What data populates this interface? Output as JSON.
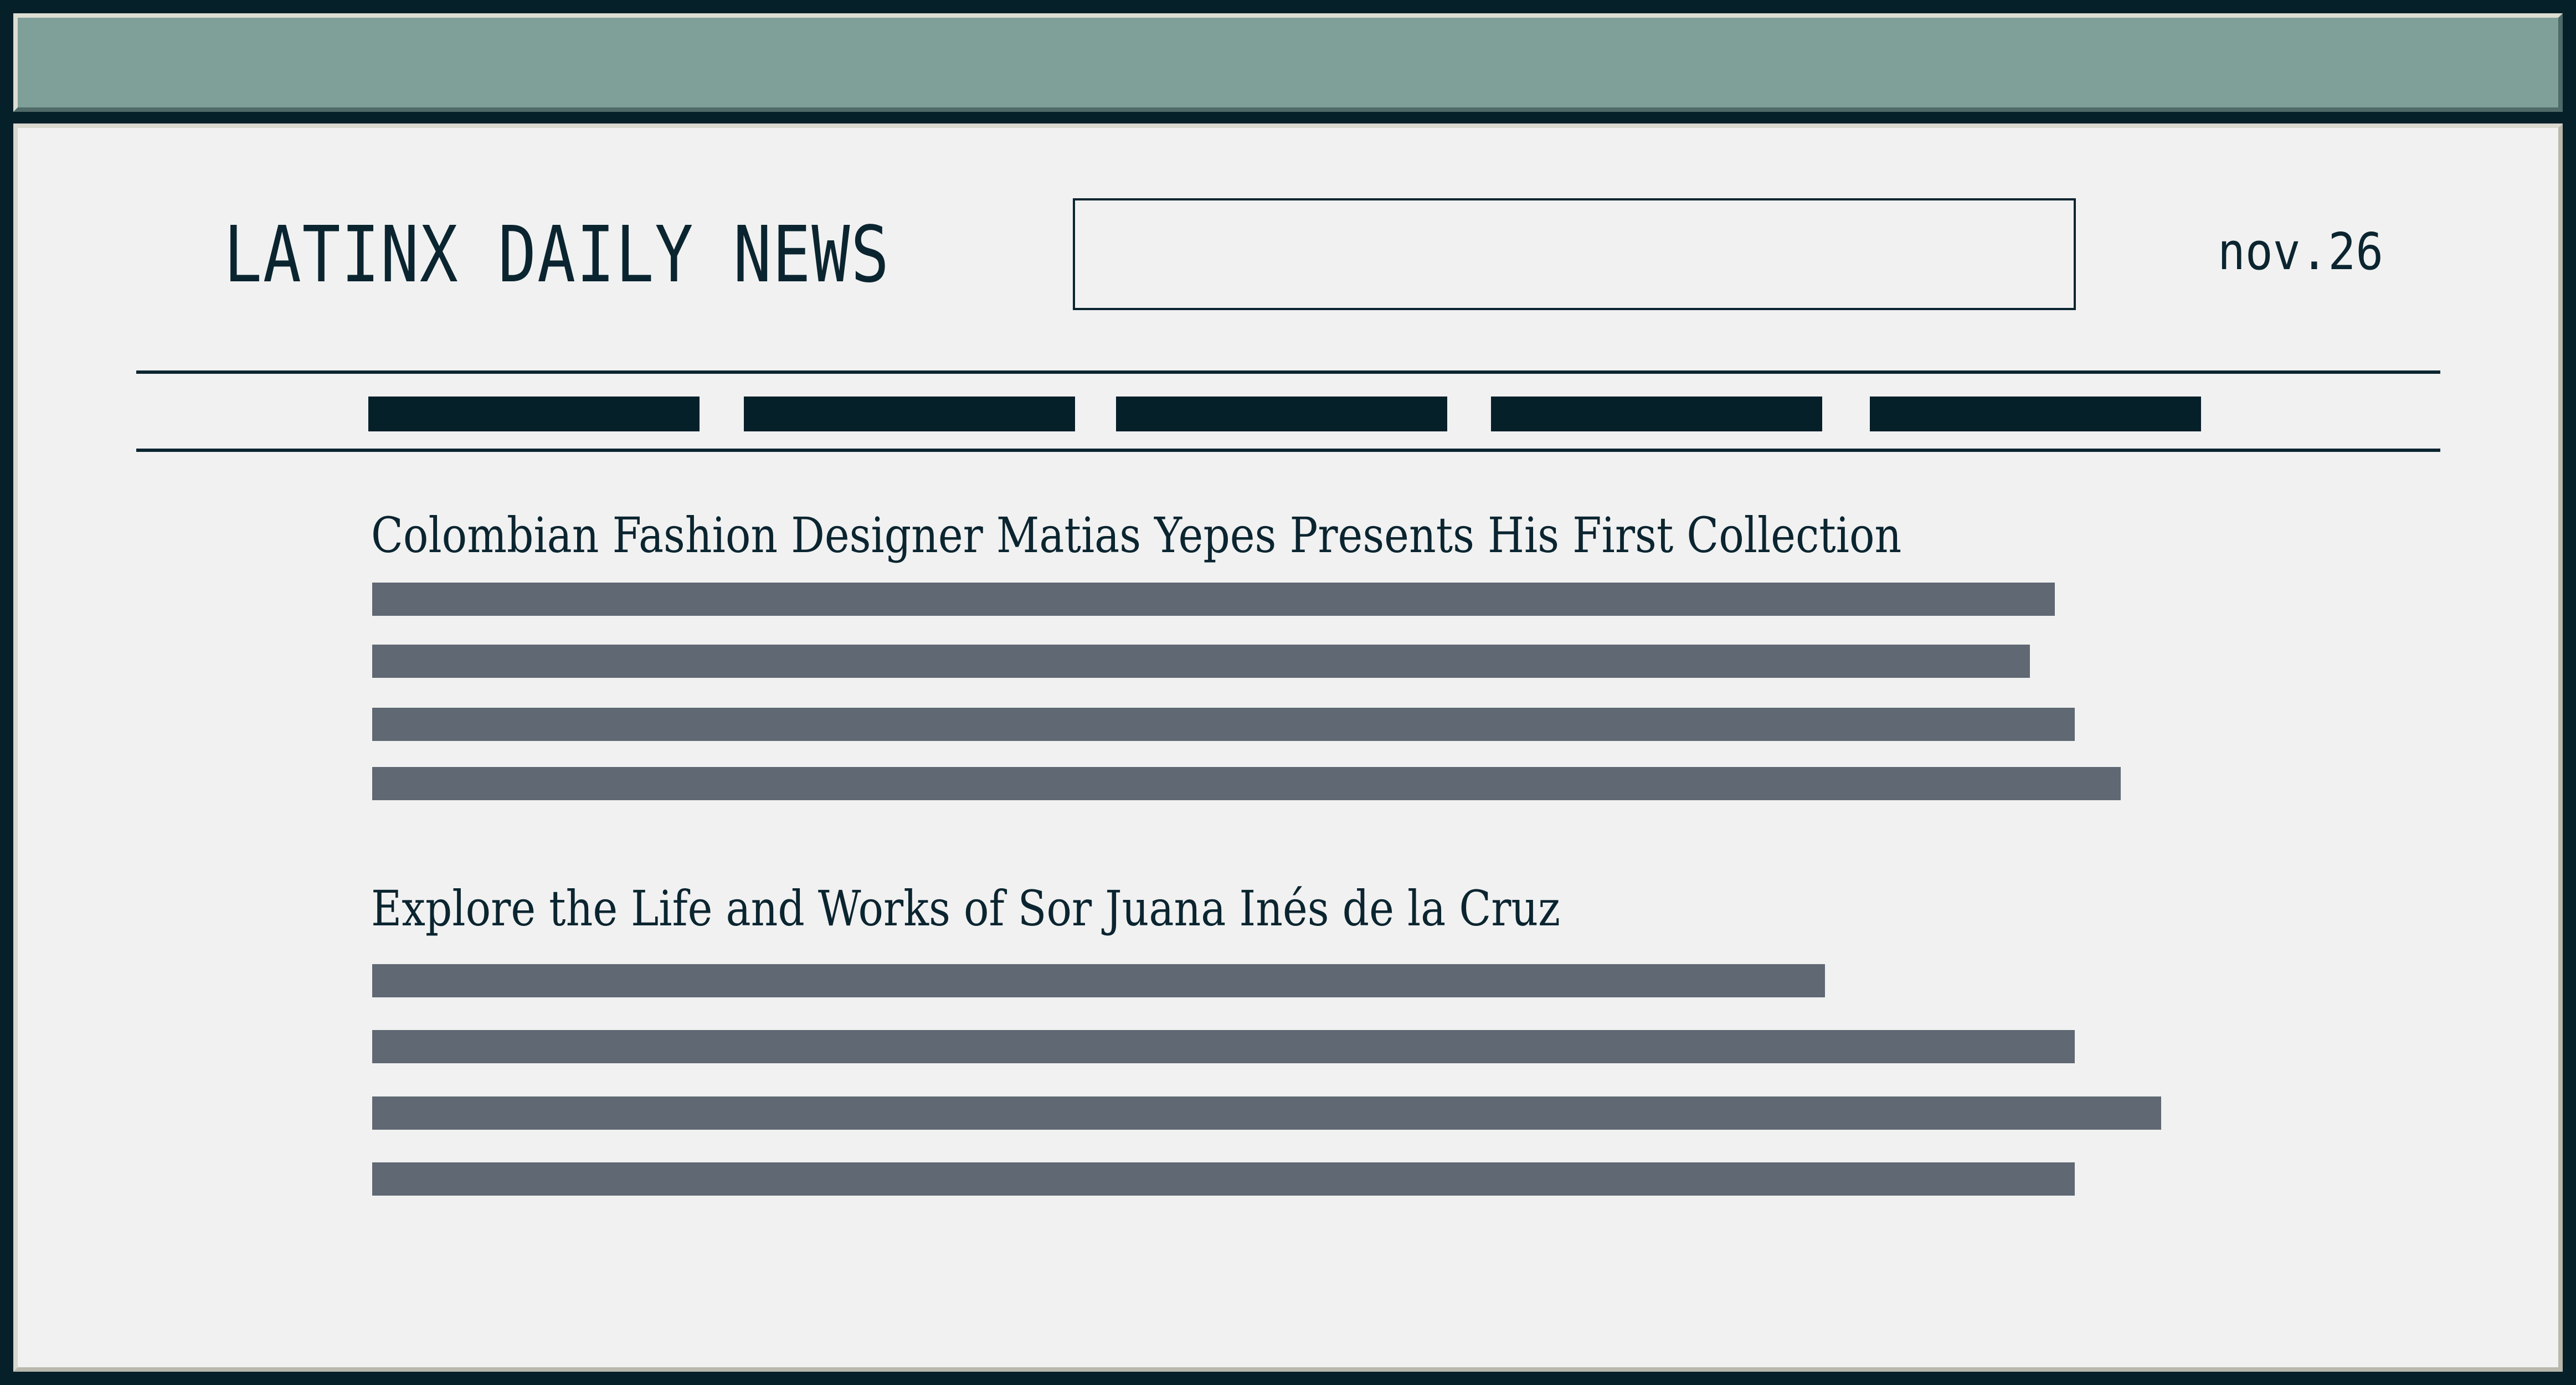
{
  "site": {
    "title": "LATINX DAILY NEWS",
    "date": "nov.26"
  },
  "search": {
    "value": "",
    "placeholder": ""
  },
  "nav": {
    "tabs": [
      "",
      "",
      "",
      "",
      ""
    ]
  },
  "articles": [
    {
      "headline": "Colombian Fashion Designer Matias Yepes Presents His First Collection"
    },
    {
      "headline": "Explore the Life and Works of Sor Juana Inés de la Cruz"
    }
  ],
  "colors": {
    "frame": "#06202a",
    "titlebar": "#7f9f99",
    "page": "#f1f1f1",
    "text": "#0b2530",
    "placeholder_lines": "#5f6873"
  }
}
